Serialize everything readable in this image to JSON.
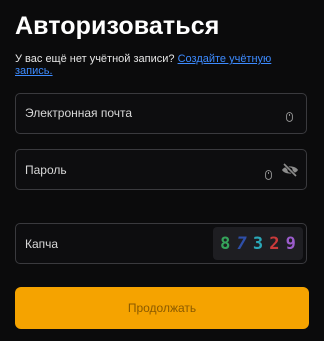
{
  "header": {
    "title": "Авторизоваться"
  },
  "signup_prompt": {
    "text": "У вас ещё нет учётной записи?",
    "link_label": "Создайте учётную запись."
  },
  "form": {
    "email": {
      "placeholder": "Электронная почта",
      "value": ""
    },
    "password": {
      "placeholder": "Пароль",
      "value": ""
    },
    "captcha": {
      "placeholder": "Капча",
      "value": "",
      "image_digits": [
        "8",
        "7",
        "3",
        "2",
        "9"
      ]
    },
    "submit_label": "Продолжать"
  },
  "icons": {
    "email_field": "mouse-icon",
    "password_field": "mouse-icon",
    "password_toggle": "eye-slash-icon"
  },
  "colors": {
    "background": "#0b0b0c",
    "accent": "#f5a300",
    "link": "#3d8bff",
    "field_border": "#3a3a3e"
  }
}
